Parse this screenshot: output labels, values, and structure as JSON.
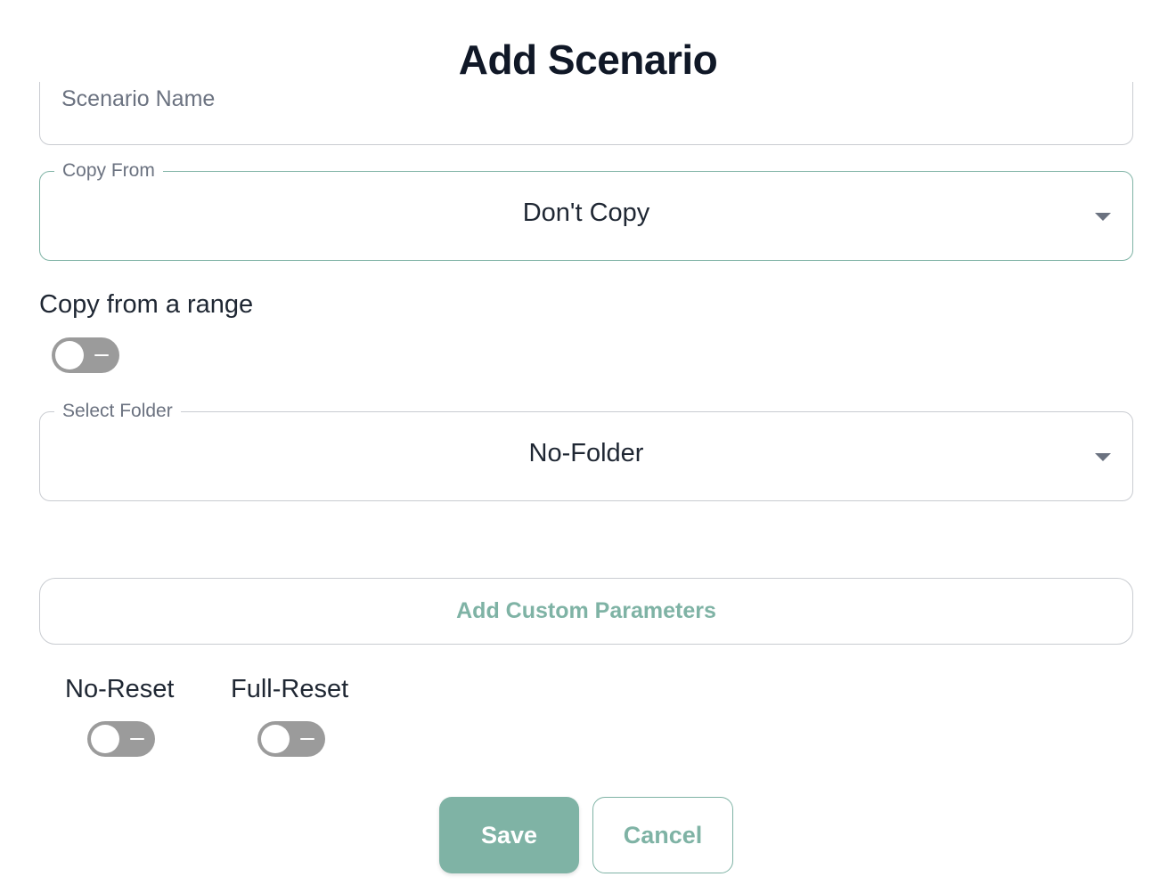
{
  "dialog": {
    "title": "Add Scenario"
  },
  "scenario_name": {
    "placeholder": "Scenario Name",
    "value": ""
  },
  "copy_from": {
    "label": "Copy From",
    "selected": "Don't Copy"
  },
  "copy_range": {
    "label": "Copy from a range",
    "enabled": false
  },
  "folder": {
    "label": "Select Folder",
    "selected": "No-Folder"
  },
  "custom_params": {
    "label": "Add Custom Parameters"
  },
  "reset_options": {
    "no_reset": {
      "label": "No-Reset",
      "enabled": false
    },
    "full_reset": {
      "label": "Full-Reset",
      "enabled": false
    }
  },
  "actions": {
    "save_label": "Save",
    "cancel_label": "Cancel"
  },
  "colors": {
    "accent": "#7fb3a5",
    "toggle_off": "#9b9b9b",
    "border": "#c9ccd1",
    "text": "#1f2733",
    "muted": "#6b7280"
  }
}
